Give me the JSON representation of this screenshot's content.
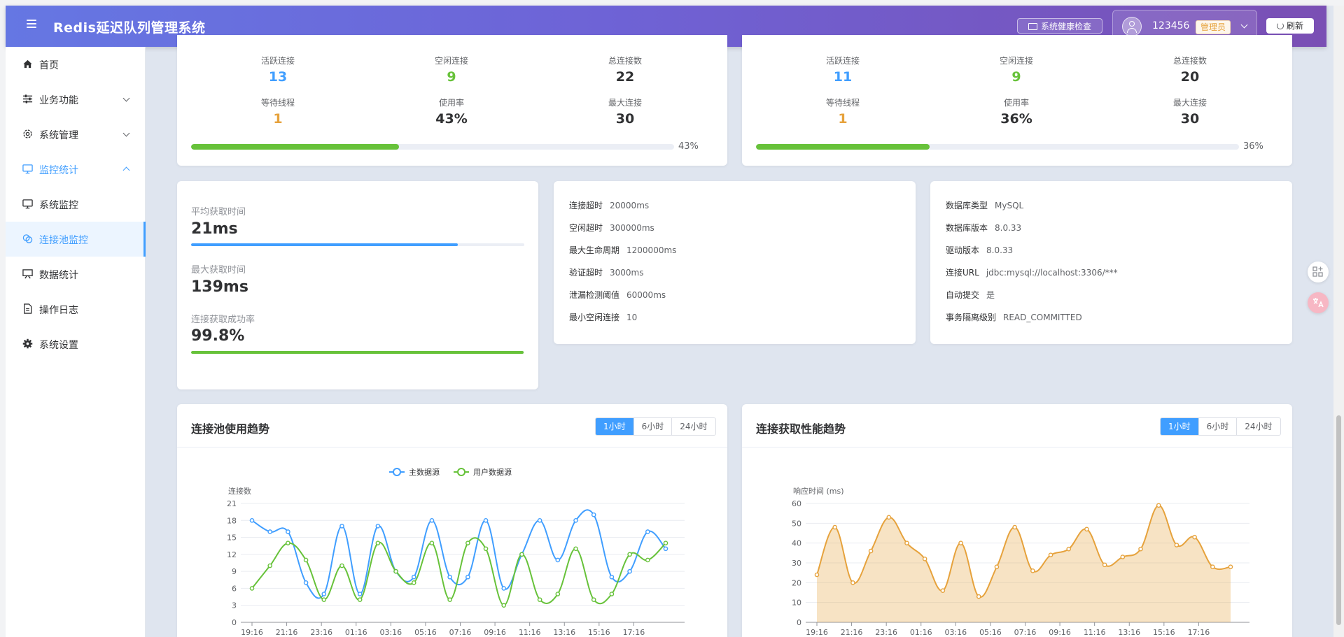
{
  "header": {
    "title": "Redis延迟队列管理系统",
    "health_check": "系统健康检查",
    "username": "123456",
    "role": "管理员",
    "refresh": "刷新"
  },
  "sidebar": {
    "items": [
      {
        "label": "首页",
        "icon": "home-icon"
      },
      {
        "label": "业务功能",
        "icon": "sliders-icon"
      },
      {
        "label": "系统管理",
        "icon": "gear-icon"
      },
      {
        "label": "监控统计",
        "icon": "monitor-icon"
      },
      {
        "label": "系统监控",
        "icon": "monitor-icon"
      },
      {
        "label": "连接池监控",
        "icon": "connection-icon"
      },
      {
        "label": "数据统计",
        "icon": "board-icon"
      },
      {
        "label": "操作日志",
        "icon": "document-icon"
      },
      {
        "label": "系统设置",
        "icon": "cog-icon"
      }
    ]
  },
  "pools": [
    {
      "stats": [
        {
          "label": "活跃连接",
          "value": "13"
        },
        {
          "label": "空闲连接",
          "value": "9"
        },
        {
          "label": "总连接数",
          "value": "22"
        },
        {
          "label": "等待线程",
          "value": "1"
        },
        {
          "label": "使用率",
          "value": "43%"
        },
        {
          "label": "最大连接",
          "value": "30"
        }
      ],
      "usage_percent": 43,
      "usage_text": "43%"
    },
    {
      "stats": [
        {
          "label": "活跃连接",
          "value": "11"
        },
        {
          "label": "空闲连接",
          "value": "9"
        },
        {
          "label": "总连接数",
          "value": "20"
        },
        {
          "label": "等待线程",
          "value": "1"
        },
        {
          "label": "使用率",
          "value": "36%"
        },
        {
          "label": "最大连接",
          "value": "30"
        }
      ],
      "usage_percent": 36,
      "usage_text": "36%"
    }
  ],
  "performance": {
    "avg_label": "平均获取时间",
    "avg_value": "21ms",
    "avg_fill_percent": 80,
    "max_label": "最大获取时间",
    "max_value": "139ms",
    "success_label": "连接获取成功率",
    "success_value": "99.8%",
    "success_fill_percent": 99.8
  },
  "pool_config": [
    {
      "key": "连接超时",
      "value": "20000ms"
    },
    {
      "key": "空闲超时",
      "value": "300000ms"
    },
    {
      "key": "最大生命周期",
      "value": "1200000ms"
    },
    {
      "key": "验证超时",
      "value": "3000ms"
    },
    {
      "key": "泄漏检测阈值",
      "value": "60000ms"
    },
    {
      "key": "最小空闲连接",
      "value": "10"
    }
  ],
  "db_info": [
    {
      "key": "数据库类型",
      "value": "MySQL"
    },
    {
      "key": "数据库版本",
      "value": "8.0.33"
    },
    {
      "key": "驱动版本",
      "value": "8.0.33"
    },
    {
      "key": "连接URL",
      "value": "jdbc:mysql://localhost:3306/***"
    },
    {
      "key": "自动提交",
      "value": "是"
    },
    {
      "key": "事务隔离级别",
      "value": "READ_COMMITTED"
    }
  ],
  "chart_panels": [
    {
      "title": "连接池使用趋势",
      "ranges": [
        "1小时",
        "6小时",
        "24小时"
      ],
      "active": 0
    },
    {
      "title": "连接获取性能趋势",
      "ranges": [
        "1小时",
        "6小时",
        "24小时"
      ],
      "active": 0
    }
  ],
  "colors": {
    "blue": "#409eff",
    "green": "#67c23a",
    "orange": "#e6a23c"
  },
  "chart_data": [
    {
      "type": "line",
      "title": "",
      "ylabel": "连接数",
      "ylim": [
        0,
        21
      ],
      "yticks": [
        0,
        3,
        6,
        9,
        12,
        15,
        18,
        21
      ],
      "xticks": [
        "19:16",
        "21:16",
        "23:16",
        "01:16",
        "03:16",
        "05:16",
        "07:16",
        "09:16",
        "11:16",
        "13:16",
        "15:16",
        "17:16"
      ],
      "legend": "top-center",
      "grid": true,
      "smooth": true,
      "x": [
        0,
        1,
        2,
        3,
        4,
        5,
        6,
        7,
        8,
        9,
        10,
        11,
        12,
        13,
        14,
        15,
        16,
        17,
        18,
        19,
        20,
        21,
        22,
        23
      ],
      "series": [
        {
          "name": "主数据源",
          "color": "#409eff",
          "values": [
            18,
            16,
            16,
            7,
            5,
            17,
            5,
            17,
            9,
            8,
            18,
            8,
            8,
            18,
            6,
            12,
            18,
            11,
            18,
            19,
            8,
            9,
            16,
            13
          ]
        },
        {
          "name": "用户数据源",
          "color": "#67c23a",
          "values": [
            6,
            10,
            14,
            11,
            4,
            10,
            4,
            14,
            9,
            7,
            14,
            4,
            14,
            13,
            3,
            12,
            4,
            5,
            13,
            4,
            5,
            12,
            11,
            14
          ]
        }
      ]
    },
    {
      "type": "area",
      "title": "",
      "ylabel": "响应时间 (ms)",
      "ylim": [
        0,
        60
      ],
      "yticks": [
        0,
        10,
        20,
        30,
        40,
        50,
        60
      ],
      "xticks": [
        "19:16",
        "21:16",
        "23:16",
        "01:16",
        "03:16",
        "05:16",
        "07:16",
        "09:16",
        "11:16",
        "13:16",
        "15:16",
        "17:16"
      ],
      "grid": true,
      "smooth": true,
      "x": [
        0,
        1,
        2,
        3,
        4,
        5,
        6,
        7,
        8,
        9,
        10,
        11,
        12,
        13,
        14,
        15,
        16,
        17,
        18,
        19,
        20,
        21,
        22,
        23
      ],
      "series": [
        {
          "color": "#e6a23c",
          "values": [
            24,
            48,
            20,
            36,
            53,
            40,
            32,
            16,
            40,
            13,
            28,
            48,
            26,
            34,
            37,
            47,
            29,
            33,
            37,
            59,
            39,
            43,
            28,
            28
          ]
        }
      ]
    }
  ]
}
